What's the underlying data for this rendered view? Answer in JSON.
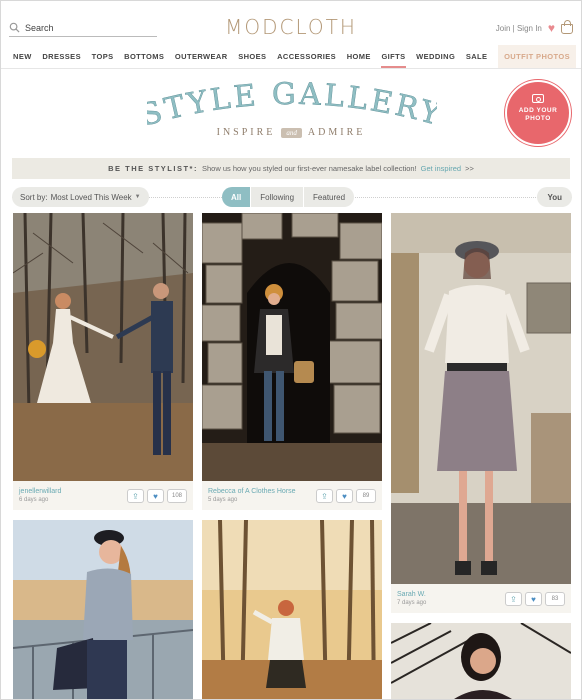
{
  "header": {
    "search_placeholder": "Search",
    "logo": "MODCLOTH",
    "account": "Join | Sign In"
  },
  "nav": [
    "NEW",
    "DRESSES",
    "TOPS",
    "BOTTOMS",
    "OUTERWEAR",
    "SHOES",
    "ACCESSORIES",
    "HOME",
    "GIFTS",
    "WEDDING",
    "SALE",
    "OUTFIT PHOTOS"
  ],
  "hero": {
    "title": "STYLE GALLERY",
    "tagline_left": "INSPIRE",
    "tagline_amp": "and",
    "tagline_right": "ADMIRE",
    "badge_line1": "ADD YOUR",
    "badge_line2": "PHOTO"
  },
  "stylist": {
    "title": "BE THE STYLIST*:",
    "text": "Show us how you styled our first-ever namesake label collection!",
    "link": "Get inspired",
    "arrow": ">>"
  },
  "controls": {
    "sort_label": "Sort by:",
    "sort_value": "Most Loved This Week",
    "filters": [
      "All",
      "Following",
      "Featured"
    ],
    "you": "You"
  },
  "cards": [
    {
      "user": "jenellerwillard",
      "ago": "6 days ago",
      "likes": "108"
    },
    {
      "user": "Rebecca of A Clothes Horse",
      "ago": "5 days ago",
      "likes": "89"
    },
    {
      "user": "Sarah W.",
      "ago": "7 days ago",
      "likes": "83"
    }
  ],
  "colors": {
    "accent": "#8fbec3",
    "brand": "#b39877",
    "badge": "#e8676c",
    "link": "#66a7b0"
  }
}
